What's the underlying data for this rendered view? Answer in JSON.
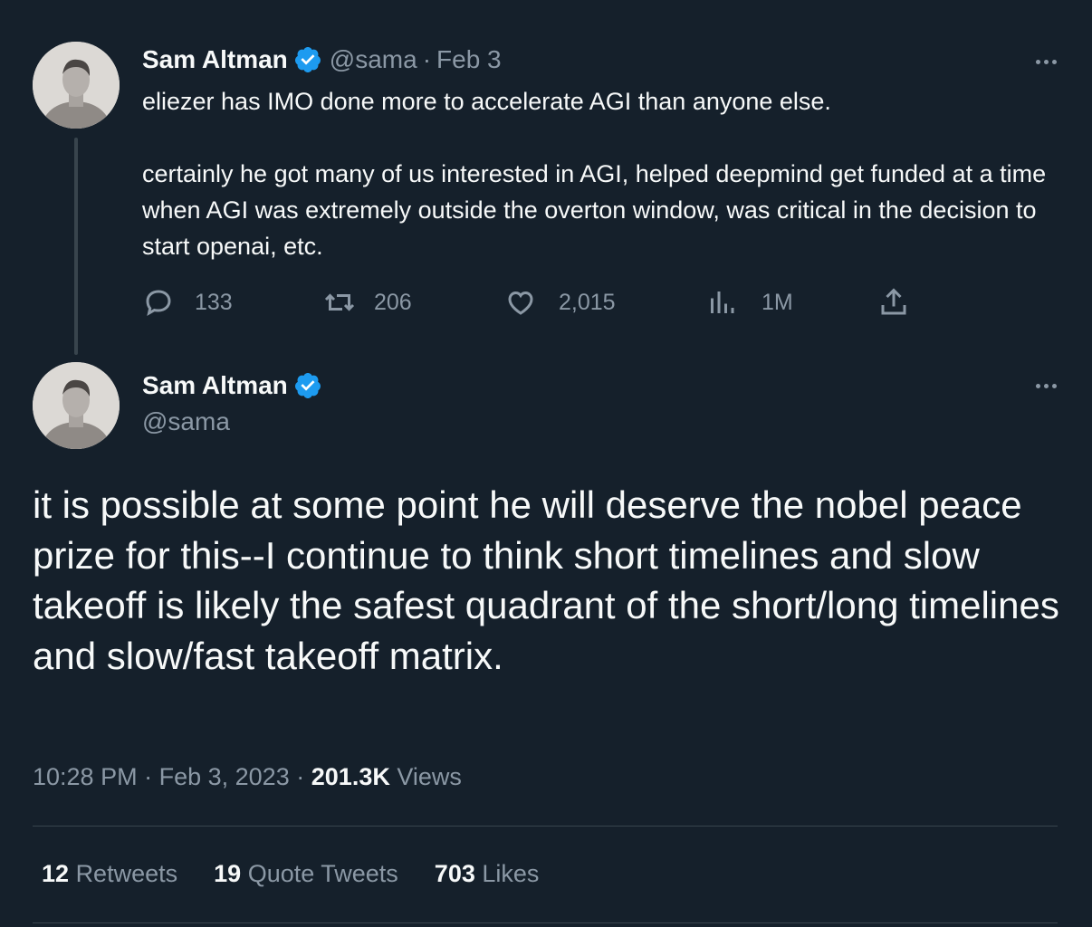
{
  "tweet1": {
    "author_name": "Sam Altman",
    "handle": "@sama",
    "separator": "·",
    "date": "Feb 3",
    "paragraphs": [
      "eliezer has IMO done more to accelerate AGI than anyone else.",
      "certainly he got many of us interested in AGI, helped deepmind get funded at a time when AGI was extremely outside the overton window, was critical in the decision to start openai, etc."
    ],
    "actions": {
      "replies": "133",
      "retweets": "206",
      "likes": "2,015",
      "views": "1M"
    },
    "icons": [
      "reply-icon",
      "retweet-icon",
      "like-icon",
      "views-icon",
      "share-icon",
      "more-icon",
      "verified-icon"
    ]
  },
  "tweet2": {
    "author_name": "Sam Altman",
    "handle": "@sama",
    "text": "it is possible at some point he will deserve the nobel peace prize for this--I continue to think short timelines and slow takeoff is likely the safest quadrant of the short/long timelines and slow/fast takeoff matrix.",
    "time": "10:28 PM",
    "separator": "·",
    "full_date": "Feb 3, 2023",
    "views_count": "201.3K",
    "views_label": "Views",
    "stats": {
      "retweets_count": "12",
      "retweets_label": "Retweets",
      "quotes_count": "19",
      "quotes_label": "Quote Tweets",
      "likes_count": "703",
      "likes_label": "Likes"
    }
  },
  "colors": {
    "background": "#15202b",
    "text": "#f7f9f9",
    "muted": "#8b98a5",
    "verified": "#1d9bf0",
    "border": "#38444d"
  }
}
